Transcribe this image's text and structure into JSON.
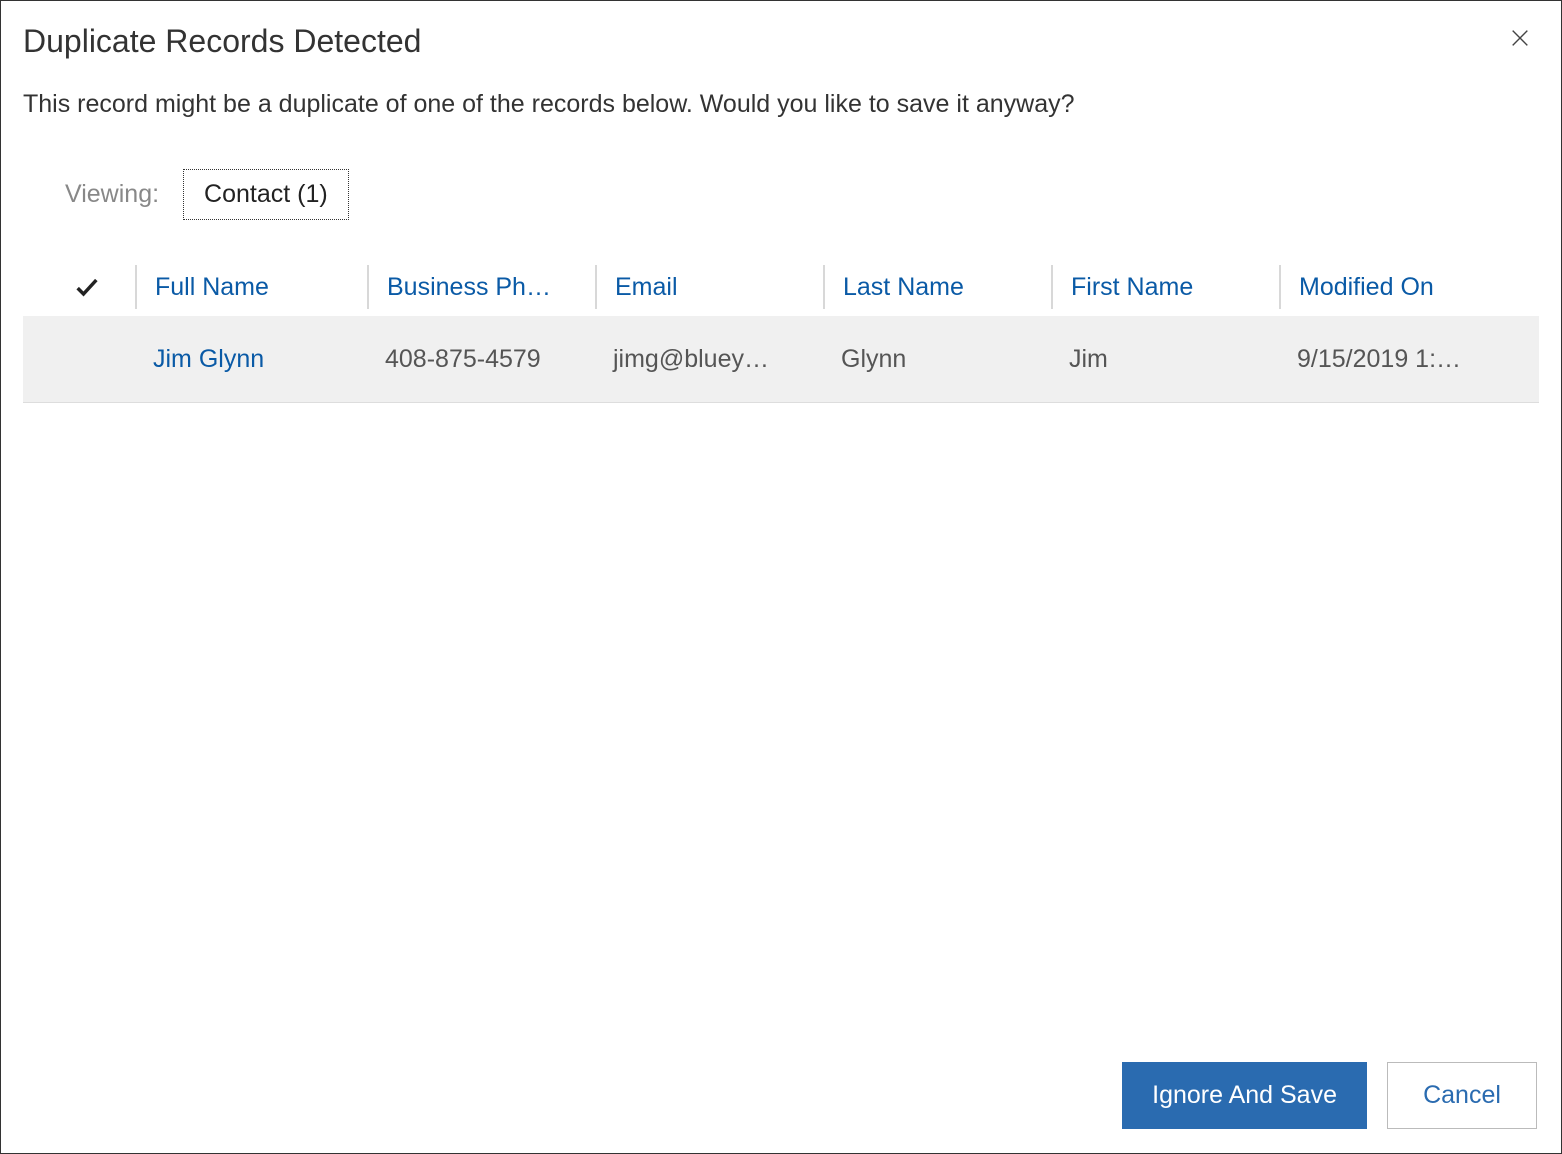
{
  "dialog": {
    "title": "Duplicate Records Detected",
    "message": "This record might be a duplicate of one of the records below. Would you like to save it anyway?"
  },
  "viewing": {
    "label": "Viewing:",
    "selected": "Contact (1)"
  },
  "table": {
    "columns": {
      "fullname": "Full Name",
      "phone": "Business Ph…",
      "email": "Email",
      "lastname": "Last Name",
      "firstname": "First Name",
      "modified": "Modified On"
    },
    "rows": [
      {
        "fullname": "Jim Glynn",
        "phone": "408-875-4579",
        "email": "jimg@bluey…",
        "lastname": "Glynn",
        "firstname": "Jim",
        "modified": "9/15/2019 1:…"
      }
    ]
  },
  "footer": {
    "primary": "Ignore And Save",
    "secondary": "Cancel"
  }
}
